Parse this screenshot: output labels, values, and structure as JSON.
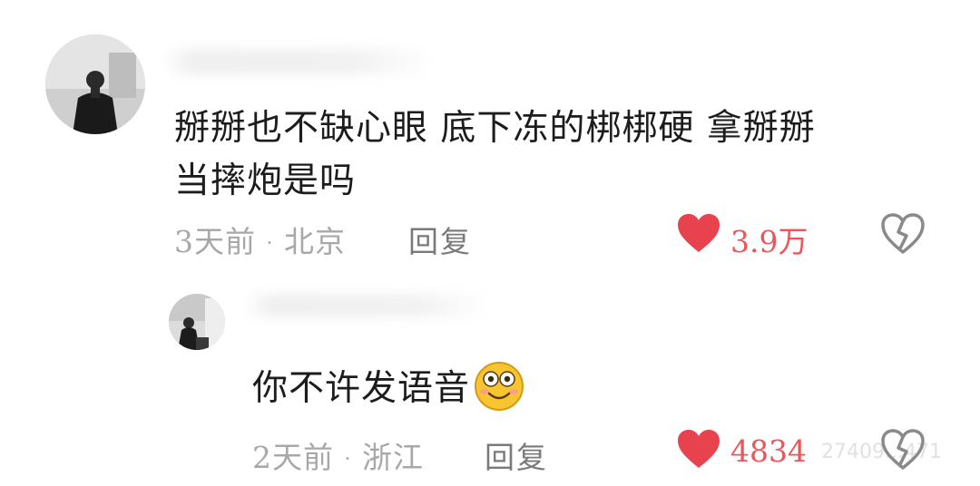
{
  "comments": [
    {
      "username": "",
      "text_line1": "掰掰也不缺心眼 底下冻的梆梆硬 拿掰掰",
      "text_line2": "当摔炮是吗",
      "time": "3天前",
      "location": "北京",
      "reply_label": "回复",
      "likes": "3.9万"
    },
    {
      "username": "",
      "text": "你不许发语音",
      "emoji": "smiley-emoji",
      "time": "2天前",
      "location": "浙江",
      "reply_label": "回复",
      "likes": "4834"
    }
  ],
  "meta_separator": "·",
  "watermark": "27409...471",
  "icons": {
    "like": "heart-icon",
    "dislike": "broken-heart-icon"
  },
  "colors": {
    "like": "#e8424e",
    "meta": "#a8a8a8",
    "text": "#1c1c1c"
  }
}
